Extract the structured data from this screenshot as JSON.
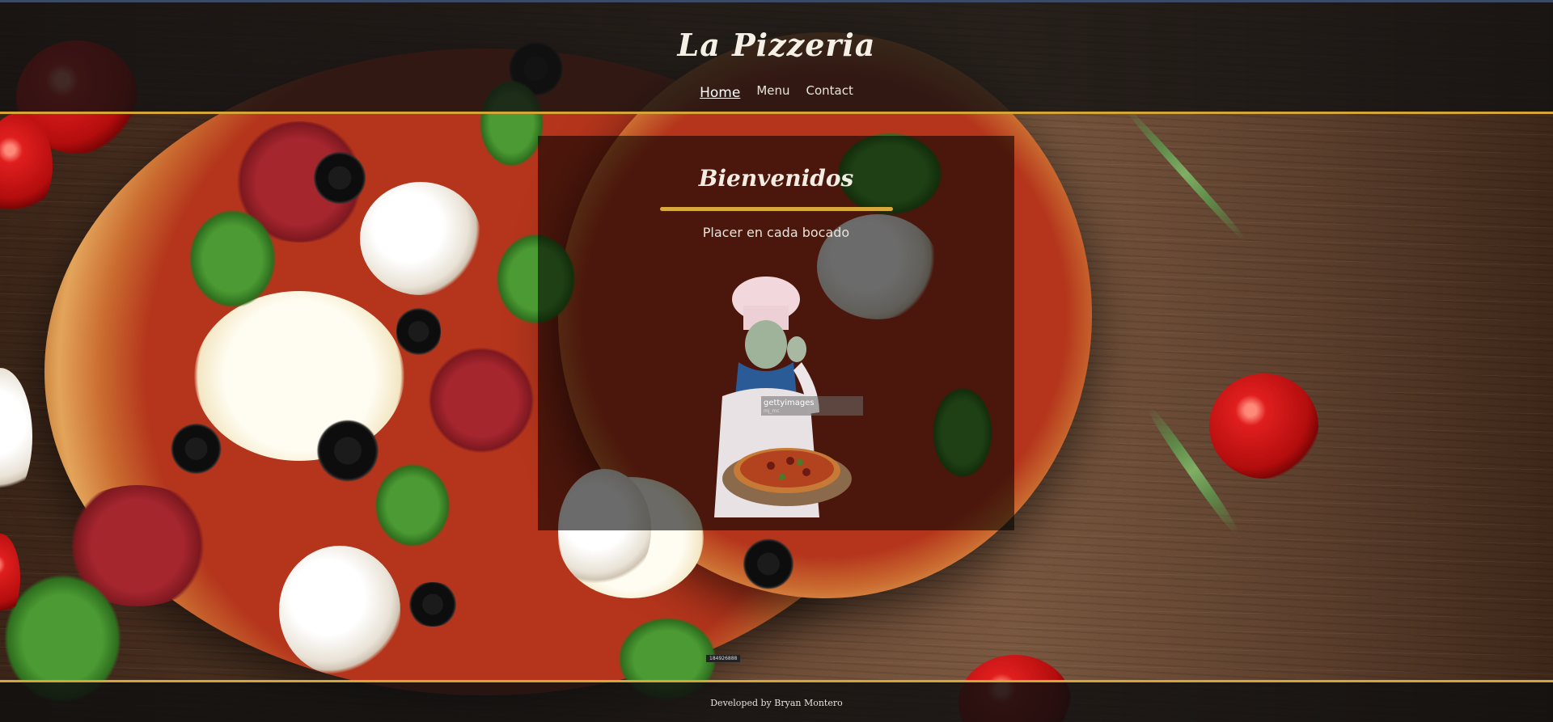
{
  "site": {
    "logo": "La Pizzeria"
  },
  "nav": {
    "items": [
      {
        "label": "Home",
        "active": true
      },
      {
        "label": "Menu",
        "active": false
      },
      {
        "label": "Contact",
        "active": false
      }
    ]
  },
  "hero": {
    "heading": "Bienvenidos",
    "tagline": "Placer en cada bocado",
    "image_watermark": "gettyimages",
    "image_credit": "mj_mc",
    "image_id": "184926888"
  },
  "footer": {
    "credit": "Developed by Bryan Montero"
  },
  "colors": {
    "accent": "#d9a93d",
    "overlay": "#000000",
    "text": "#f2ece2"
  }
}
